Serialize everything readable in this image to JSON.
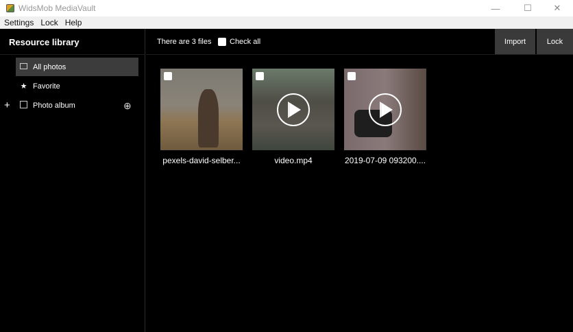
{
  "window": {
    "title": "WidsMob MediaVault",
    "minimize": "—",
    "maximize": "☐",
    "close": "✕"
  },
  "menu": [
    "Settings",
    "Lock",
    "Help"
  ],
  "sidebar": {
    "title": "Resource library",
    "items": [
      {
        "label": "All photos",
        "icon": "photo-frame-icon",
        "selected": true
      },
      {
        "label": "Favorite",
        "icon": "star-icon"
      },
      {
        "label": "Photo album",
        "icon": "album-icon"
      }
    ],
    "expand": "+",
    "add": "⊕"
  },
  "header": {
    "count_text": "There are 3 files",
    "check_all": "Check all",
    "import": "Import",
    "lock": "Lock"
  },
  "files": [
    {
      "name": "pexels-david-selber...",
      "type": "photo"
    },
    {
      "name": "video.mp4",
      "type": "video"
    },
    {
      "name": "2019-07-09 093200....",
      "type": "video"
    }
  ]
}
